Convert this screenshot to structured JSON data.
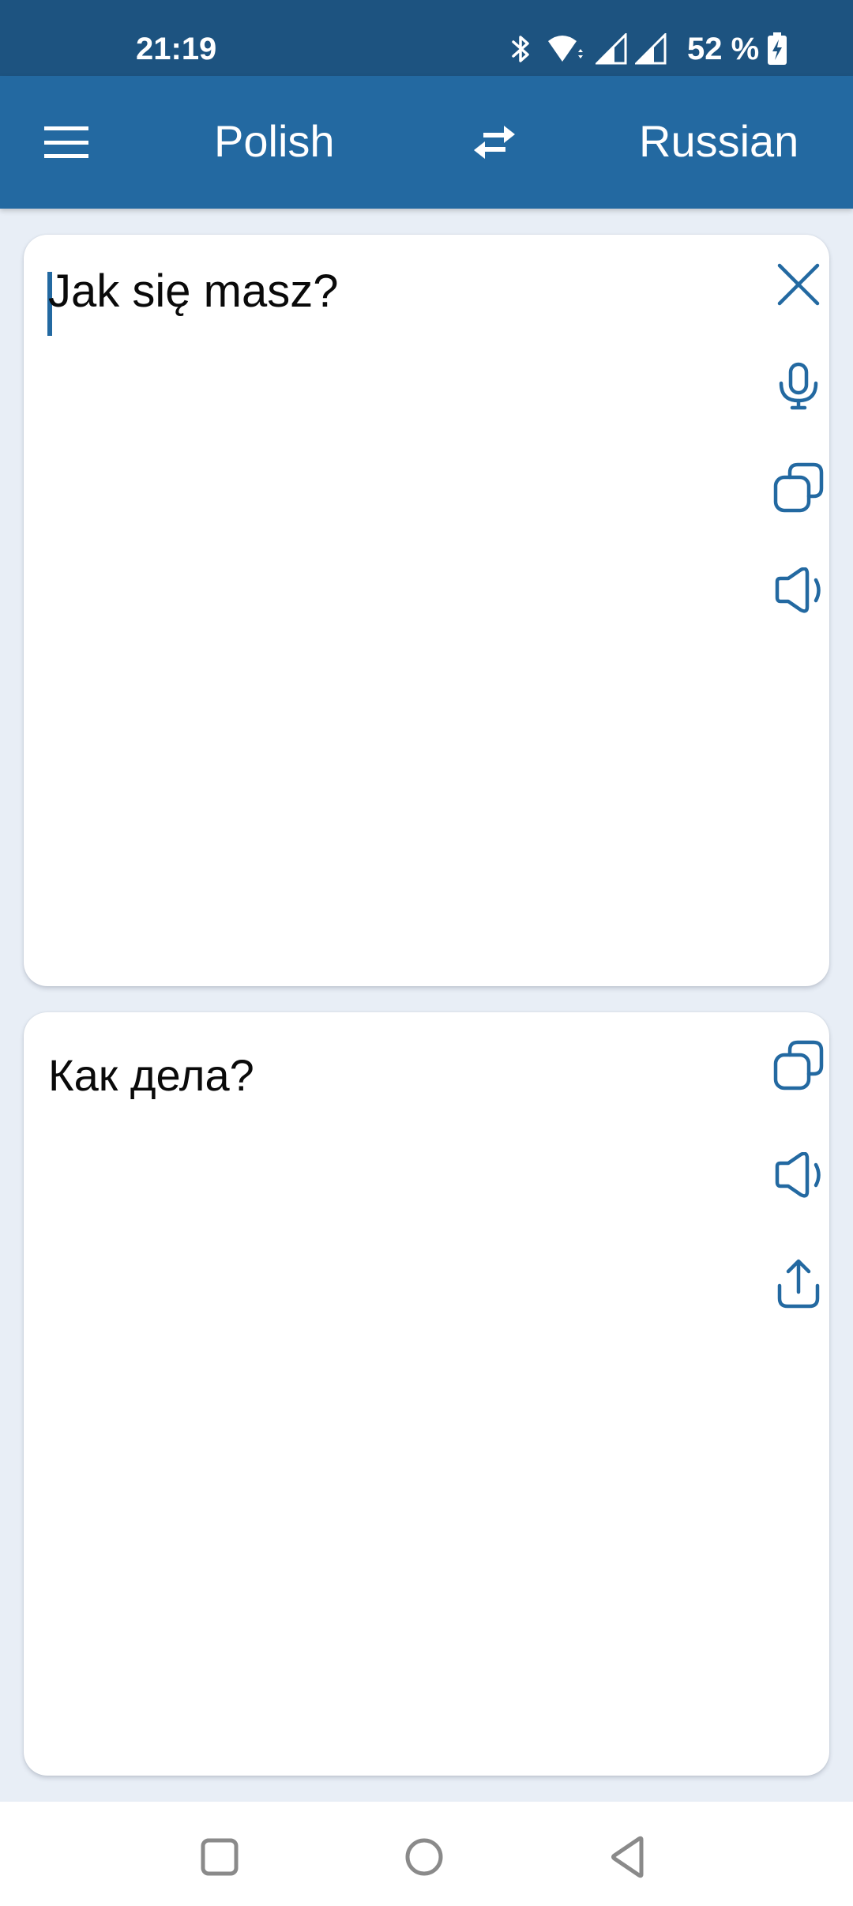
{
  "status_bar": {
    "time": "21:19",
    "battery_percent": "52 %",
    "icons": [
      "bluetooth-icon",
      "wifi-icon",
      "signal-icon",
      "signal-icon",
      "battery-charging-icon"
    ]
  },
  "app_bar": {
    "menu_icon": "hamburger-menu-icon",
    "source_language": "Polish",
    "swap_icon": "swap-arrows-icon",
    "target_language": "Russian"
  },
  "input_card": {
    "text": "Jak się masz?",
    "actions": [
      {
        "name": "clear",
        "icon": "close-icon"
      },
      {
        "name": "voice-input",
        "icon": "microphone-icon"
      },
      {
        "name": "copy",
        "icon": "copy-icon"
      },
      {
        "name": "speak",
        "icon": "speaker-icon"
      }
    ]
  },
  "output_card": {
    "text": "Как дела?",
    "actions": [
      {
        "name": "copy",
        "icon": "copy-icon"
      },
      {
        "name": "speak",
        "icon": "speaker-icon"
      },
      {
        "name": "share",
        "icon": "share-icon"
      }
    ]
  },
  "nav_bar": {
    "buttons": [
      {
        "name": "recents",
        "icon": "square-icon"
      },
      {
        "name": "home",
        "icon": "circle-icon"
      },
      {
        "name": "back",
        "icon": "back-triangle-icon"
      }
    ]
  },
  "colors": {
    "status_bar": "#1d5380",
    "app_bar": "#2369a1",
    "accent": "#2369a1",
    "background": "#e8eef6",
    "nav_icon": "#8a8a8a"
  }
}
